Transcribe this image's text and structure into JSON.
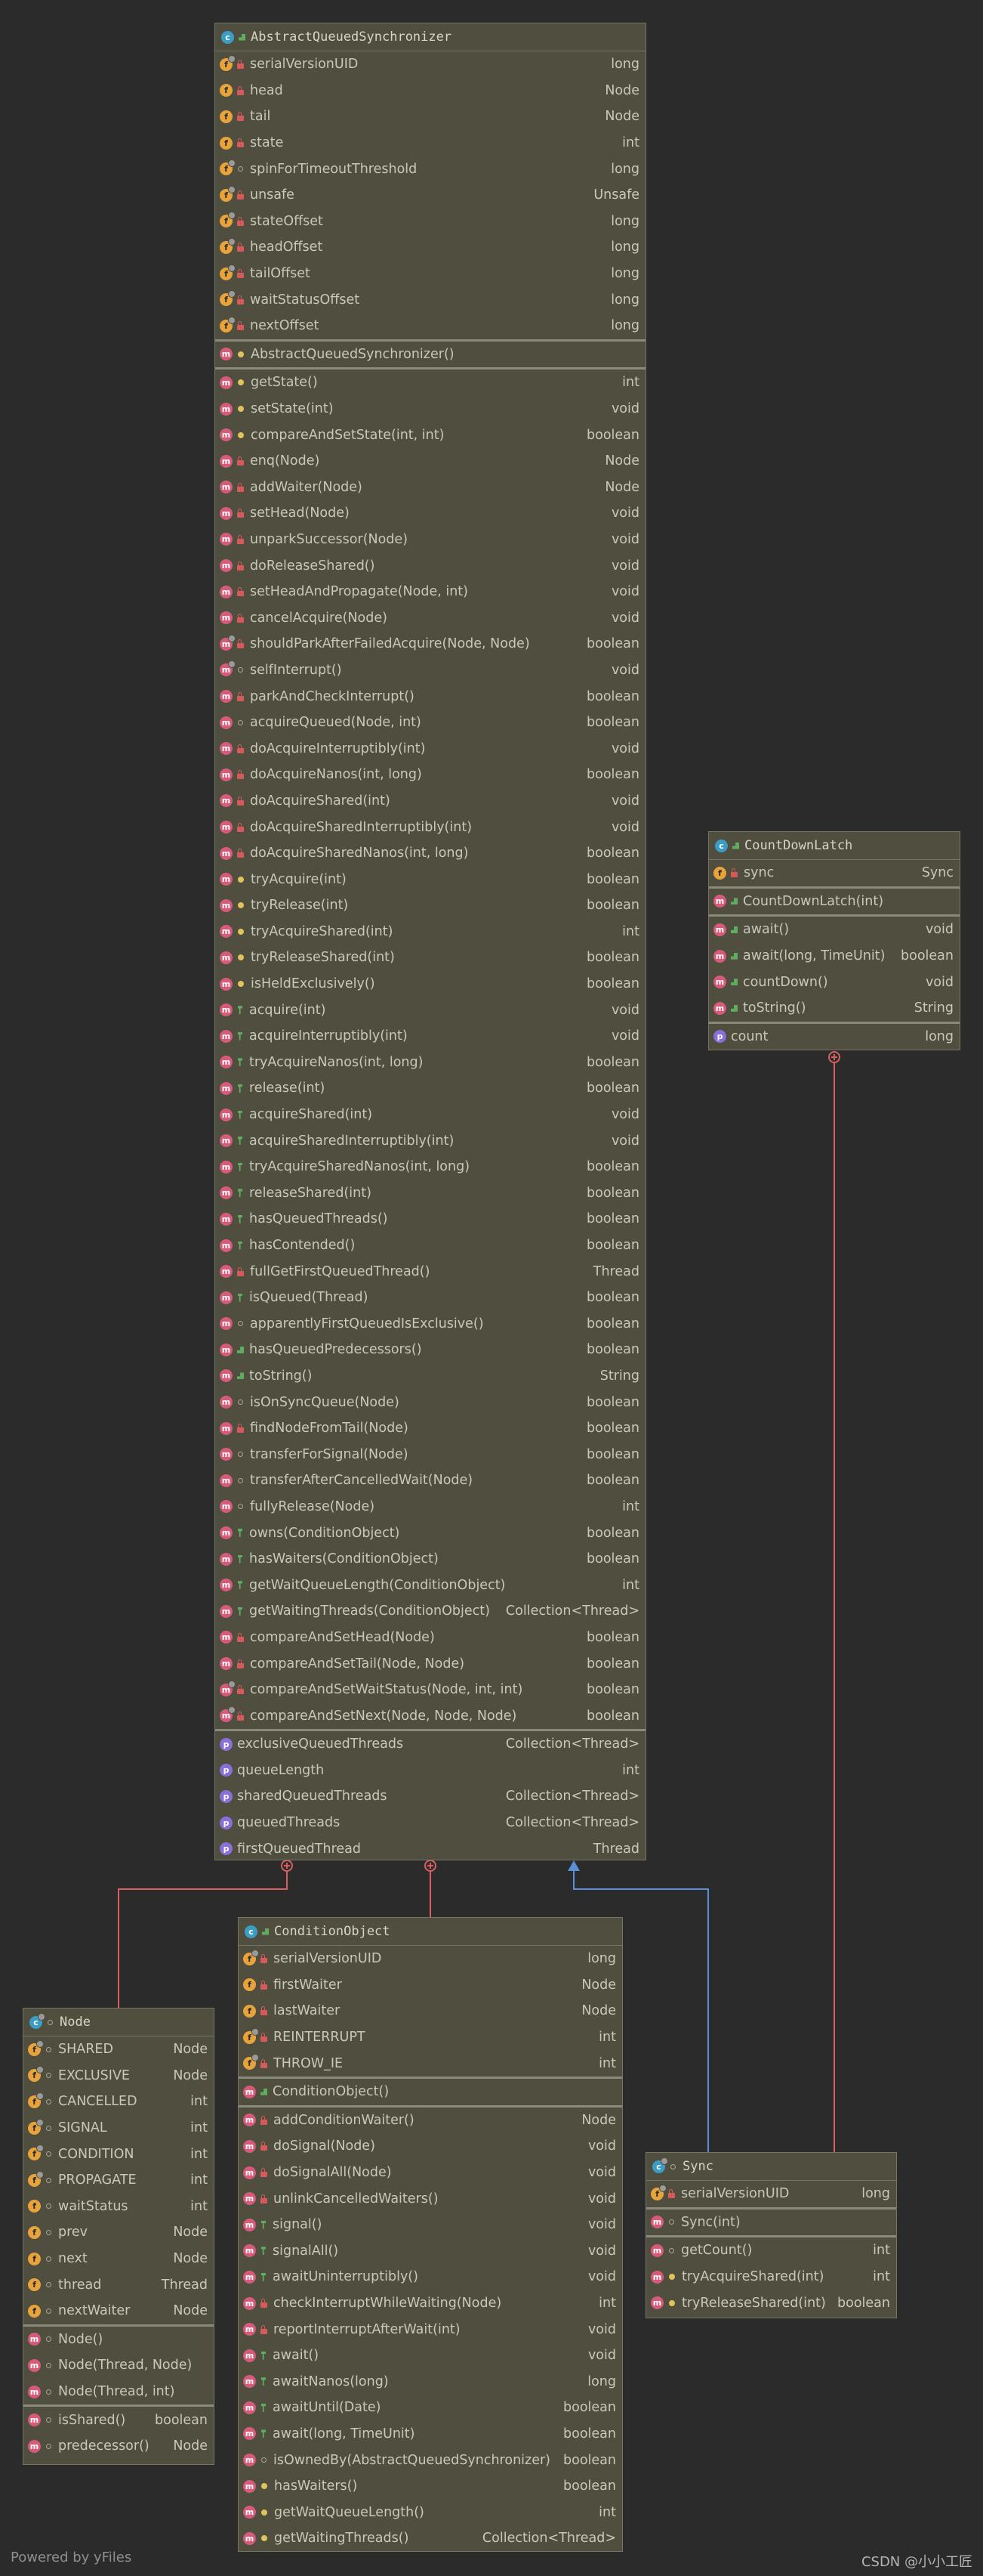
{
  "classes": [
    {
      "key": "aqs",
      "title": "AbstractQueuedSynchronizer",
      "title_icon": "class-icon",
      "abstract": true,
      "sections": [
        [
          {
            "k": "f",
            "v": "priv",
            "s": true,
            "n": "serialVersionUID",
            "t": "long"
          },
          {
            "k": "f",
            "v": "priv",
            "n": "head",
            "t": "Node"
          },
          {
            "k": "f",
            "v": "priv",
            "n": "tail",
            "t": "Node"
          },
          {
            "k": "f",
            "v": "priv",
            "n": "state",
            "t": "int"
          },
          {
            "k": "f",
            "v": "pkg",
            "s": true,
            "n": "spinForTimeoutThreshold",
            "t": "long"
          },
          {
            "k": "f",
            "v": "priv",
            "s": true,
            "n": "unsafe",
            "t": "Unsafe"
          },
          {
            "k": "f",
            "v": "priv",
            "s": true,
            "n": "stateOffset",
            "t": "long"
          },
          {
            "k": "f",
            "v": "priv",
            "s": true,
            "n": "headOffset",
            "t": "long"
          },
          {
            "k": "f",
            "v": "priv",
            "s": true,
            "n": "tailOffset",
            "t": "long"
          },
          {
            "k": "f",
            "v": "priv",
            "s": true,
            "n": "waitStatusOffset",
            "t": "long"
          },
          {
            "k": "f",
            "v": "priv",
            "s": true,
            "n": "nextOffset",
            "t": "long"
          }
        ],
        [
          {
            "k": "m",
            "v": "prot",
            "n": "AbstractQueuedSynchronizer()",
            "t": ""
          }
        ],
        [
          {
            "k": "m",
            "v": "prot",
            "n": "getState()",
            "t": "int"
          },
          {
            "k": "m",
            "v": "prot",
            "n": "setState(int)",
            "t": "void"
          },
          {
            "k": "m",
            "v": "prot",
            "n": "compareAndSetState(int, int)",
            "t": "boolean"
          },
          {
            "k": "m",
            "v": "priv",
            "n": "enq(Node)",
            "t": "Node"
          },
          {
            "k": "m",
            "v": "priv",
            "n": "addWaiter(Node)",
            "t": "Node"
          },
          {
            "k": "m",
            "v": "priv",
            "n": "setHead(Node)",
            "t": "void"
          },
          {
            "k": "m",
            "v": "priv",
            "n": "unparkSuccessor(Node)",
            "t": "void"
          },
          {
            "k": "m",
            "v": "priv",
            "n": "doReleaseShared()",
            "t": "void"
          },
          {
            "k": "m",
            "v": "priv",
            "n": "setHeadAndPropagate(Node, int)",
            "t": "void"
          },
          {
            "k": "m",
            "v": "priv",
            "n": "cancelAcquire(Node)",
            "t": "void"
          },
          {
            "k": "m",
            "v": "priv",
            "s": true,
            "n": "shouldParkAfterFailedAcquire(Node, Node)",
            "t": "boolean"
          },
          {
            "k": "m",
            "v": "pkg",
            "s": true,
            "n": "selfInterrupt()",
            "t": "void"
          },
          {
            "k": "m",
            "v": "priv",
            "n": "parkAndCheckInterrupt()",
            "t": "boolean"
          },
          {
            "k": "m",
            "v": "pkg",
            "n": "acquireQueued(Node, int)",
            "t": "boolean"
          },
          {
            "k": "m",
            "v": "priv",
            "n": "doAcquireInterruptibly(int)",
            "t": "void"
          },
          {
            "k": "m",
            "v": "priv",
            "n": "doAcquireNanos(int, long)",
            "t": "boolean"
          },
          {
            "k": "m",
            "v": "priv",
            "n": "doAcquireShared(int)",
            "t": "void"
          },
          {
            "k": "m",
            "v": "priv",
            "n": "doAcquireSharedInterruptibly(int)",
            "t": "void"
          },
          {
            "k": "m",
            "v": "priv",
            "n": "doAcquireSharedNanos(int, long)",
            "t": "boolean"
          },
          {
            "k": "m",
            "v": "prot",
            "n": "tryAcquire(int)",
            "t": "boolean"
          },
          {
            "k": "m",
            "v": "prot",
            "n": "tryRelease(int)",
            "t": "boolean"
          },
          {
            "k": "m",
            "v": "prot",
            "n": "tryAcquireShared(int)",
            "t": "int"
          },
          {
            "k": "m",
            "v": "prot",
            "n": "tryReleaseShared(int)",
            "t": "boolean"
          },
          {
            "k": "m",
            "v": "prot",
            "n": "isHeldExclusively()",
            "t": "boolean"
          },
          {
            "k": "m",
            "v": "pubk",
            "n": "acquire(int)",
            "t": "void"
          },
          {
            "k": "m",
            "v": "pubk",
            "n": "acquireInterruptibly(int)",
            "t": "void"
          },
          {
            "k": "m",
            "v": "pubk",
            "n": "tryAcquireNanos(int, long)",
            "t": "boolean"
          },
          {
            "k": "m",
            "v": "pubk",
            "n": "release(int)",
            "t": "boolean"
          },
          {
            "k": "m",
            "v": "pubk",
            "n": "acquireShared(int)",
            "t": "void"
          },
          {
            "k": "m",
            "v": "pubk",
            "n": "acquireSharedInterruptibly(int)",
            "t": "void"
          },
          {
            "k": "m",
            "v": "pubk",
            "n": "tryAcquireSharedNanos(int, long)",
            "t": "boolean"
          },
          {
            "k": "m",
            "v": "pubk",
            "n": "releaseShared(int)",
            "t": "boolean"
          },
          {
            "k": "m",
            "v": "pubk",
            "n": "hasQueuedThreads()",
            "t": "boolean"
          },
          {
            "k": "m",
            "v": "pubk",
            "n": "hasContended()",
            "t": "boolean"
          },
          {
            "k": "m",
            "v": "priv",
            "n": "fullGetFirstQueuedThread()",
            "t": "Thread"
          },
          {
            "k": "m",
            "v": "pubk",
            "n": "isQueued(Thread)",
            "t": "boolean"
          },
          {
            "k": "m",
            "v": "pkg",
            "n": "apparentlyFirstQueuedIsExclusive()",
            "t": "boolean"
          },
          {
            "k": "m",
            "v": "pub",
            "n": "hasQueuedPredecessors()",
            "t": "boolean"
          },
          {
            "k": "m",
            "v": "pub",
            "n": "toString()",
            "t": "String"
          },
          {
            "k": "m",
            "v": "pkg",
            "n": "isOnSyncQueue(Node)",
            "t": "boolean"
          },
          {
            "k": "m",
            "v": "priv",
            "n": "findNodeFromTail(Node)",
            "t": "boolean"
          },
          {
            "k": "m",
            "v": "pkg",
            "n": "transferForSignal(Node)",
            "t": "boolean"
          },
          {
            "k": "m",
            "v": "pkg",
            "n": "transferAfterCancelledWait(Node)",
            "t": "boolean"
          },
          {
            "k": "m",
            "v": "pkg",
            "n": "fullyRelease(Node)",
            "t": "int"
          },
          {
            "k": "m",
            "v": "pubk",
            "n": "owns(ConditionObject)",
            "t": "boolean"
          },
          {
            "k": "m",
            "v": "pubk",
            "n": "hasWaiters(ConditionObject)",
            "t": "boolean"
          },
          {
            "k": "m",
            "v": "pubk",
            "n": "getWaitQueueLength(ConditionObject)",
            "t": "int"
          },
          {
            "k": "m",
            "v": "pubk",
            "n": "getWaitingThreads(ConditionObject)",
            "t": "Collection<Thread>"
          },
          {
            "k": "m",
            "v": "priv",
            "n": "compareAndSetHead(Node)",
            "t": "boolean"
          },
          {
            "k": "m",
            "v": "priv",
            "n": "compareAndSetTail(Node, Node)",
            "t": "boolean"
          },
          {
            "k": "m",
            "v": "priv",
            "s": true,
            "n": "compareAndSetWaitStatus(Node, int, int)",
            "t": "boolean"
          },
          {
            "k": "m",
            "v": "priv",
            "s": true,
            "n": "compareAndSetNext(Node, Node, Node)",
            "t": "boolean"
          }
        ],
        [
          {
            "k": "p",
            "n": "exclusiveQueuedThreads",
            "t": "Collection<Thread>"
          },
          {
            "k": "p",
            "n": "queueLength",
            "t": "int"
          },
          {
            "k": "p",
            "n": "sharedQueuedThreads",
            "t": "Collection<Thread>"
          },
          {
            "k": "p",
            "n": "queuedThreads",
            "t": "Collection<Thread>"
          },
          {
            "k": "p",
            "n": "firstQueuedThread",
            "t": "Thread"
          }
        ]
      ]
    },
    {
      "key": "cdl",
      "title": "CountDownLatch",
      "title_icon": "class-icon",
      "sections": [
        [
          {
            "k": "f",
            "v": "priv",
            "n": "sync",
            "t": "Sync"
          }
        ],
        [
          {
            "k": "m",
            "v": "pub",
            "n": "CountDownLatch(int)",
            "t": ""
          }
        ],
        [
          {
            "k": "m",
            "v": "pub",
            "n": "await()",
            "t": "void"
          },
          {
            "k": "m",
            "v": "pub",
            "n": "await(long, TimeUnit)",
            "t": "boolean"
          },
          {
            "k": "m",
            "v": "pub",
            "n": "countDown()",
            "t": "void"
          },
          {
            "k": "m",
            "v": "pub",
            "n": "toString()",
            "t": "String"
          }
        ],
        [
          {
            "k": "p",
            "n": "count",
            "t": "long"
          }
        ]
      ]
    },
    {
      "key": "cond",
      "title": "ConditionObject",
      "title_icon": "class-icon",
      "sections": [
        [
          {
            "k": "f",
            "v": "priv",
            "s": true,
            "n": "serialVersionUID",
            "t": "long"
          },
          {
            "k": "f",
            "v": "priv",
            "n": "firstWaiter",
            "t": "Node"
          },
          {
            "k": "f",
            "v": "priv",
            "n": "lastWaiter",
            "t": "Node"
          },
          {
            "k": "f",
            "v": "priv",
            "s": true,
            "n": "REINTERRUPT",
            "t": "int"
          },
          {
            "k": "f",
            "v": "priv",
            "s": true,
            "n": "THROW_IE",
            "t": "int"
          }
        ],
        [
          {
            "k": "m",
            "v": "pub",
            "n": "ConditionObject()",
            "t": ""
          }
        ],
        [
          {
            "k": "m",
            "v": "priv",
            "n": "addConditionWaiter()",
            "t": "Node"
          },
          {
            "k": "m",
            "v": "priv",
            "n": "doSignal(Node)",
            "t": "void"
          },
          {
            "k": "m",
            "v": "priv",
            "n": "doSignalAll(Node)",
            "t": "void"
          },
          {
            "k": "m",
            "v": "priv",
            "n": "unlinkCancelledWaiters()",
            "t": "void"
          },
          {
            "k": "m",
            "v": "pubk",
            "n": "signal()",
            "t": "void"
          },
          {
            "k": "m",
            "v": "pubk",
            "n": "signalAll()",
            "t": "void"
          },
          {
            "k": "m",
            "v": "pubk",
            "n": "awaitUninterruptibly()",
            "t": "void"
          },
          {
            "k": "m",
            "v": "priv",
            "n": "checkInterruptWhileWaiting(Node)",
            "t": "int"
          },
          {
            "k": "m",
            "v": "priv",
            "n": "reportInterruptAfterWait(int)",
            "t": "void"
          },
          {
            "k": "m",
            "v": "pubk",
            "n": "await()",
            "t": "void"
          },
          {
            "k": "m",
            "v": "pubk",
            "n": "awaitNanos(long)",
            "t": "long"
          },
          {
            "k": "m",
            "v": "pubk",
            "n": "awaitUntil(Date)",
            "t": "boolean"
          },
          {
            "k": "m",
            "v": "pubk",
            "n": "await(long, TimeUnit)",
            "t": "boolean"
          },
          {
            "k": "m",
            "v": "pkg",
            "n": "isOwnedBy(AbstractQueuedSynchronizer)",
            "t": "boolean"
          },
          {
            "k": "m",
            "v": "prot",
            "n": "hasWaiters()",
            "t": "boolean"
          },
          {
            "k": "m",
            "v": "prot",
            "n": "getWaitQueueLength()",
            "t": "int"
          },
          {
            "k": "m",
            "v": "prot",
            "n": "getWaitingThreads()",
            "t": "Collection<Thread>"
          }
        ]
      ]
    },
    {
      "key": "node",
      "title": "Node",
      "title_icon": "class-icon",
      "static_cls": true,
      "sections": [
        [
          {
            "k": "f",
            "v": "pkg",
            "s": true,
            "n": "SHARED",
            "t": "Node"
          },
          {
            "k": "f",
            "v": "pkg",
            "s": true,
            "n": "EXCLUSIVE",
            "t": "Node"
          },
          {
            "k": "f",
            "v": "pkg",
            "s": true,
            "n": "CANCELLED",
            "t": "int"
          },
          {
            "k": "f",
            "v": "pkg",
            "s": true,
            "n": "SIGNAL",
            "t": "int"
          },
          {
            "k": "f",
            "v": "pkg",
            "s": true,
            "n": "CONDITION",
            "t": "int"
          },
          {
            "k": "f",
            "v": "pkg",
            "s": true,
            "n": "PROPAGATE",
            "t": "int"
          },
          {
            "k": "f",
            "v": "pkg",
            "n": "waitStatus",
            "t": "int"
          },
          {
            "k": "f",
            "v": "pkg",
            "n": "prev",
            "t": "Node"
          },
          {
            "k": "f",
            "v": "pkg",
            "n": "next",
            "t": "Node"
          },
          {
            "k": "f",
            "v": "pkg",
            "n": "thread",
            "t": "Thread"
          },
          {
            "k": "f",
            "v": "pkg",
            "n": "nextWaiter",
            "t": "Node"
          }
        ],
        [
          {
            "k": "m",
            "v": "pkg",
            "n": "Node()",
            "t": ""
          },
          {
            "k": "m",
            "v": "pkg",
            "n": "Node(Thread, Node)",
            "t": ""
          },
          {
            "k": "m",
            "v": "pkg",
            "n": "Node(Thread, int)",
            "t": ""
          }
        ],
        [
          {
            "k": "m",
            "v": "pkg",
            "n": "isShared()",
            "t": "boolean"
          },
          {
            "k": "m",
            "v": "pkg",
            "n": "predecessor()",
            "t": "Node"
          }
        ]
      ]
    },
    {
      "key": "sync",
      "title": "Sync",
      "title_icon": "class-icon",
      "static_cls": true,
      "sections": [
        [
          {
            "k": "f",
            "v": "priv",
            "s": true,
            "n": "serialVersionUID",
            "t": "long"
          }
        ],
        [
          {
            "k": "m",
            "v": "pkg",
            "n": "Sync(int)",
            "t": ""
          }
        ],
        [
          {
            "k": "m",
            "v": "pkg",
            "n": "getCount()",
            "t": "int"
          },
          {
            "k": "m",
            "v": "prot",
            "n": "tryAcquireShared(int)",
            "t": "int"
          },
          {
            "k": "m",
            "v": "prot",
            "n": "tryReleaseShared(int)",
            "t": "boolean"
          }
        ]
      ]
    }
  ],
  "colors": {
    "inner_link": "#d95f5f",
    "inherit_link": "#5a8fd6"
  },
  "footer": {
    "left": "Powered by yFiles",
    "right": "CSDN @小小工匠"
  }
}
